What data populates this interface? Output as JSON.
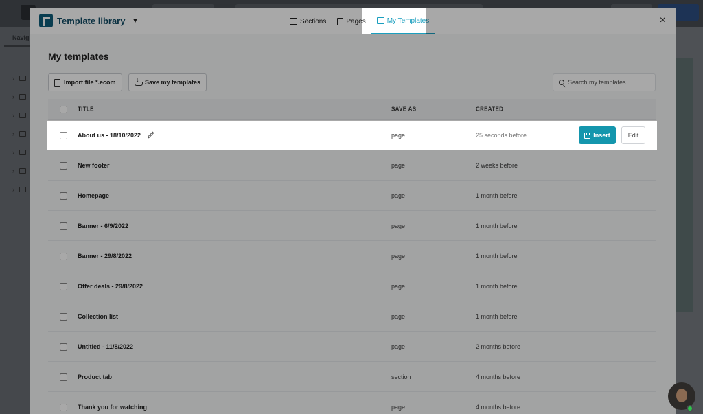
{
  "modal": {
    "title": "Template library",
    "tabs": [
      {
        "label": "Sections",
        "icon": "sections-icon"
      },
      {
        "label": "Pages",
        "icon": "pages-icon"
      },
      {
        "label": "My Templates",
        "icon": "templates-icon",
        "active": true
      }
    ],
    "close_icon": "×"
  },
  "background": {
    "nav_label": "Navig"
  },
  "page": {
    "title": "My templates",
    "import_label": "Import file *.ecom",
    "save_label": "Save my templates",
    "search_placeholder": "Search my templates"
  },
  "table": {
    "headers": {
      "title": "TITLE",
      "save_as": "SAVE AS",
      "created": "CREATED"
    },
    "rows": [
      {
        "title": "About us - 18/10/2022",
        "save_as": "page",
        "created": "25 seconds before",
        "highlighted": true
      },
      {
        "title": "New footer",
        "save_as": "page",
        "created": "2 weeks before"
      },
      {
        "title": "Homepage",
        "save_as": "page",
        "created": "1 month before"
      },
      {
        "title": "Banner - 6/9/2022",
        "save_as": "page",
        "created": "1 month before"
      },
      {
        "title": "Banner - 29/8/2022",
        "save_as": "page",
        "created": "1 month before"
      },
      {
        "title": "Offer deals - 29/8/2022",
        "save_as": "page",
        "created": "1 month before"
      },
      {
        "title": "Collection list",
        "save_as": "page",
        "created": "1 month before"
      },
      {
        "title": "Untitled - 11/8/2022",
        "save_as": "page",
        "created": "2 months before"
      },
      {
        "title": "Product tab",
        "save_as": "section",
        "created": "4 months before"
      },
      {
        "title": "Thank you for watching",
        "save_as": "page",
        "created": "4 months before"
      }
    ],
    "insert_label": "Insert",
    "edit_label": "Edit"
  },
  "colors": {
    "accent": "#1a9fbf",
    "insert_button": "#1496ad",
    "brand": "#0e5d7a"
  }
}
